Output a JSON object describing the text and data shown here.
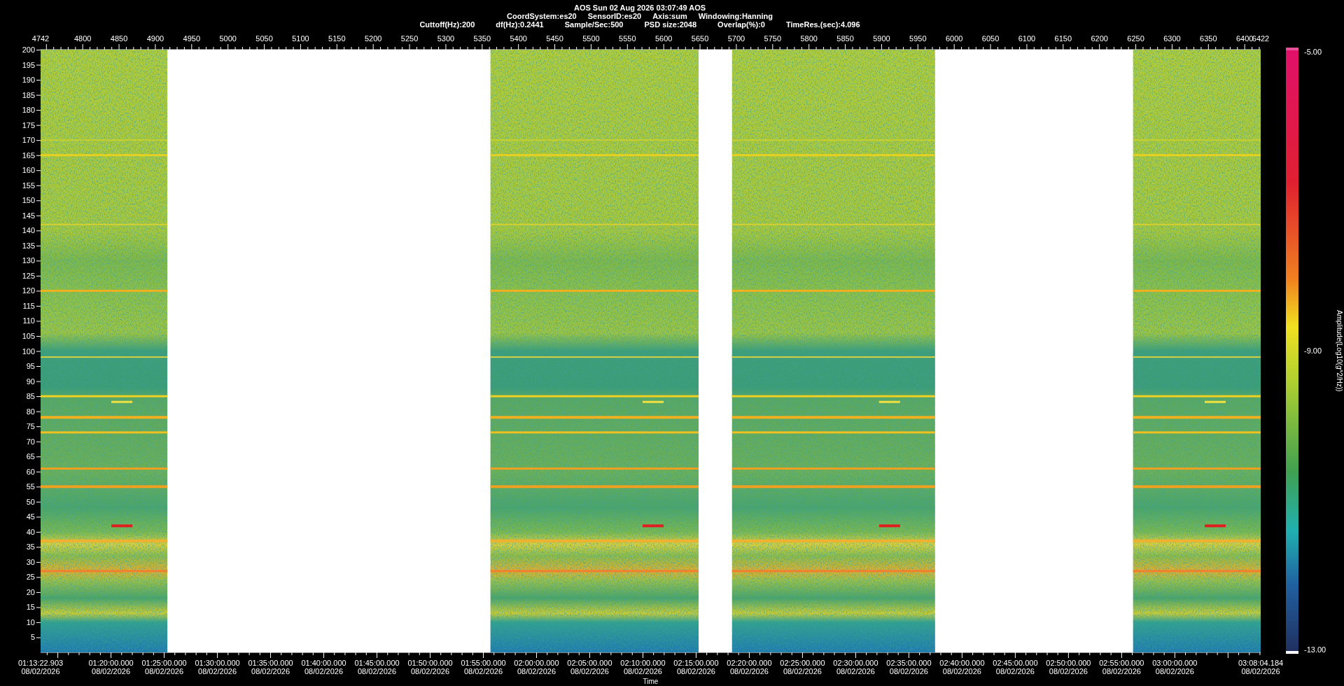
{
  "header": {
    "title": "AOS  Sun 02 Aug 2026 03:07:49  AOS",
    "line_2": [
      "CoordSystem:es20",
      "SensorID:es20",
      "Axis:sum",
      "Windowing:Hanning"
    ],
    "line_3": [
      "Cuttoff(Hz):200",
      "df(Hz):0.2441",
      "Sample/Sec:500",
      "PSD size:2048",
      "Overlap(%):0",
      "TimeRes.(sec):4.096"
    ]
  },
  "top_axis": {
    "ticks": [
      "4742",
      "4800",
      "4850",
      "4900",
      "4950",
      "5000",
      "5050",
      "5100",
      "5150",
      "5200",
      "5250",
      "5300",
      "5350",
      "5400",
      "5450",
      "5500",
      "5550",
      "5600",
      "5650",
      "5700",
      "5750",
      "5800",
      "5850",
      "5900",
      "5950",
      "6000",
      "6050",
      "6100",
      "6150",
      "6200",
      "6250",
      "6300",
      "6350",
      "6400",
      "6422"
    ]
  },
  "frequency_axis": {
    "ticks": [
      "200",
      "195",
      "190",
      "185",
      "180",
      "175",
      "170",
      "165",
      "160",
      "155",
      "150",
      "145",
      "140",
      "135",
      "130",
      "125",
      "120",
      "115",
      "110",
      "105",
      "100",
      "95",
      "90",
      "85",
      "80",
      "75",
      "70",
      "65",
      "60",
      "55",
      "50",
      "45",
      "40",
      "35",
      "30",
      "25",
      "20",
      "15",
      "10",
      "5"
    ]
  },
  "time_axis": {
    "label": "Time",
    "ticks": [
      {
        "time": "01:13:22.903",
        "date": "08/02/2026"
      },
      {
        "time": "01:20:00.000",
        "date": "08/02/2026"
      },
      {
        "time": "01:25:00.000",
        "date": "08/02/2026"
      },
      {
        "time": "01:30:00.000",
        "date": "08/02/2026"
      },
      {
        "time": "01:35:00.000",
        "date": "08/02/2026"
      },
      {
        "time": "01:40:00.000",
        "date": "08/02/2026"
      },
      {
        "time": "01:45:00.000",
        "date": "08/02/2026"
      },
      {
        "time": "01:50:00.000",
        "date": "08/02/2026"
      },
      {
        "time": "01:55:00.000",
        "date": "08/02/2026"
      },
      {
        "time": "02:00:00.000",
        "date": "08/02/2026"
      },
      {
        "time": "02:05:00.000",
        "date": "08/02/2026"
      },
      {
        "time": "02:10:00.000",
        "date": "08/02/2026"
      },
      {
        "time": "02:15:00.000",
        "date": "08/02/2026"
      },
      {
        "time": "02:20:00.000",
        "date": "08/02/2026"
      },
      {
        "time": "02:25:00.000",
        "date": "08/02/2026"
      },
      {
        "time": "02:30:00.000",
        "date": "08/02/2026"
      },
      {
        "time": "02:35:00.000",
        "date": "08/02/2026"
      },
      {
        "time": "02:40:00.000",
        "date": "08/02/2026"
      },
      {
        "time": "02:45:00.000",
        "date": "08/02/2026"
      },
      {
        "time": "02:50:00.000",
        "date": "08/02/2026"
      },
      {
        "time": "02:55:00.000",
        "date": "08/02/2026"
      },
      {
        "time": "03:00:00.000",
        "date": "08/02/2026"
      },
      {
        "time": "03:08:04.184",
        "date": "08/02/2026"
      }
    ]
  },
  "colorbar": {
    "max": "-5.00",
    "mid": "-9.00",
    "min": "-13.00",
    "label": "Amplitude(Log10(g^2/Hz))"
  }
}
